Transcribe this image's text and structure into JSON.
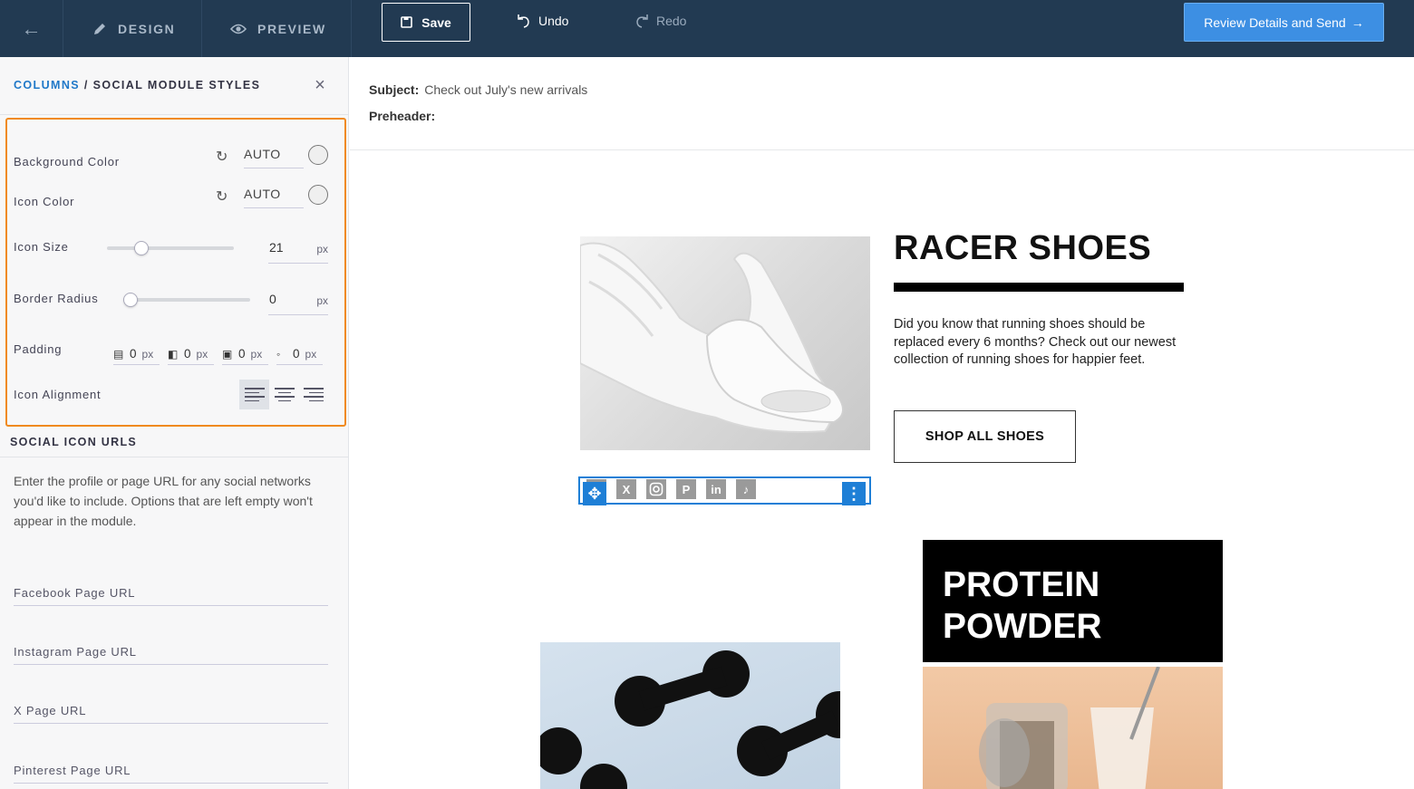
{
  "topbar": {
    "back_icon": "arrow-left-icon",
    "design_label": "DESIGN",
    "preview_label": "PREVIEW",
    "save_label": "Save",
    "undo_label": "Undo",
    "redo_label": "Redo",
    "send_label": "Review Details and Send",
    "colors": {
      "bar": "#223a52",
      "send": "#3d8fe3"
    }
  },
  "sidebar": {
    "breadcrumb_link": "COLUMNS",
    "breadcrumb_sep": " / ",
    "breadcrumb_current": "SOCIAL MODULE STYLES",
    "background_color": {
      "label": "Background Color",
      "value": "AUTO"
    },
    "icon_color": {
      "label": "Icon Color",
      "value": "AUTO"
    },
    "icon_size": {
      "label": "Icon Size",
      "value": "21",
      "unit": "px",
      "slider_fraction": 0.24
    },
    "border_radius": {
      "label": "Border Radius",
      "value": "0",
      "unit": "px",
      "slider_fraction": 0
    },
    "padding": {
      "label": "Padding",
      "top": "0",
      "right": "0",
      "bottom": "0",
      "left": "0",
      "unit": "px"
    },
    "icon_alignment": {
      "label": "Icon Alignment",
      "selected": "left"
    },
    "social_urls_title": "SOCIAL ICON URLS",
    "help_text": "Enter the profile or page URL for any social networks you'd like to include. Options that are left empty won't appear in the module.",
    "url_fields": {
      "facebook": "Facebook Page URL",
      "instagram": "Instagram Page URL",
      "x": "X Page URL",
      "pinterest": "Pinterest Page URL"
    },
    "highlight_color": "#f08a1f"
  },
  "main": {
    "subject_label": "Subject:",
    "subject_value": "Check out July's new arrivals",
    "preheader_label": "Preheader:",
    "headline": "RACER SHOES",
    "body": "Did you know that running shoes should be replaced every 6 months? Check out our newest collection of running shoes for happier feet.",
    "shop_button": "SHOP ALL SHOES",
    "social_icons": [
      "facebook-icon",
      "x-icon",
      "instagram-icon",
      "pinterest-icon",
      "linkedin-icon",
      "tiktok-icon"
    ],
    "protein_title": "PROTEIN POWDER",
    "selection_color": "#1e7fd6"
  }
}
